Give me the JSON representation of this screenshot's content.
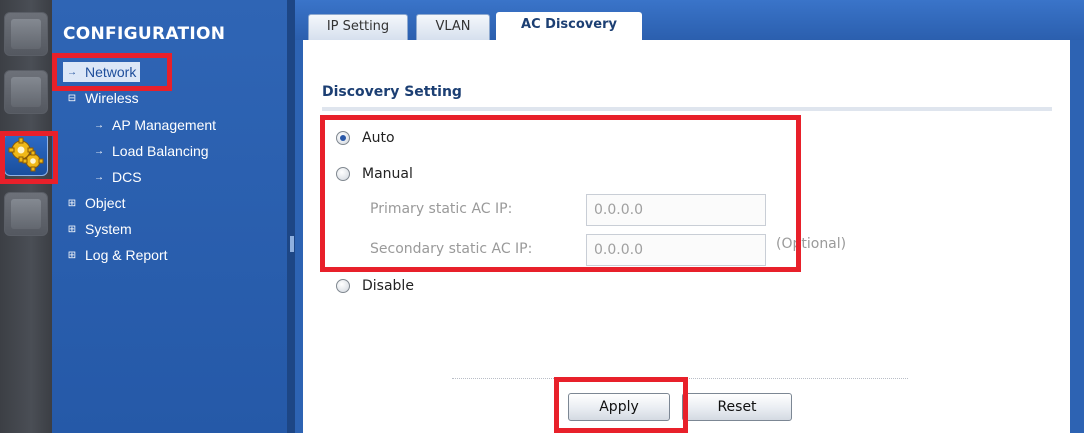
{
  "sidebar": {
    "title": "CONFIGURATION",
    "items": [
      {
        "label": "Network",
        "marker": "→",
        "selected": true
      },
      {
        "label": "Wireless",
        "marker": "⊟"
      },
      {
        "label": "AP Management",
        "marker": "→"
      },
      {
        "label": "Load Balancing",
        "marker": "→"
      },
      {
        "label": "DCS",
        "marker": "→"
      },
      {
        "label": "Object",
        "marker": "⊞"
      },
      {
        "label": "System",
        "marker": "⊞"
      },
      {
        "label": "Log & Report",
        "marker": "⊞"
      }
    ]
  },
  "tabs": [
    {
      "label": "IP Setting"
    },
    {
      "label": "VLAN"
    },
    {
      "label": "AC Discovery",
      "active": true
    }
  ],
  "discovery": {
    "section_title": "Discovery Setting",
    "options": [
      {
        "label": "Auto",
        "checked": true
      },
      {
        "label": "Manual",
        "checked": false
      },
      {
        "label": "Disable",
        "checked": false
      }
    ],
    "primary_label": "Primary static AC IP:",
    "primary_value": "0.0.0.0",
    "secondary_label": "Secondary static AC IP:",
    "secondary_value": "0.0.0.0",
    "optional_note": "(Optional)"
  },
  "buttons": {
    "apply": "Apply",
    "reset": "Reset"
  },
  "colors": {
    "sidebar_bg": "#2f65b5",
    "highlight": "#e8202a",
    "section_title": "#1c3f73"
  },
  "icons": {
    "rail": [
      "monitor-icon",
      "dashboard-icon",
      "configuration-gears-icon",
      "maintenance-icon"
    ]
  }
}
